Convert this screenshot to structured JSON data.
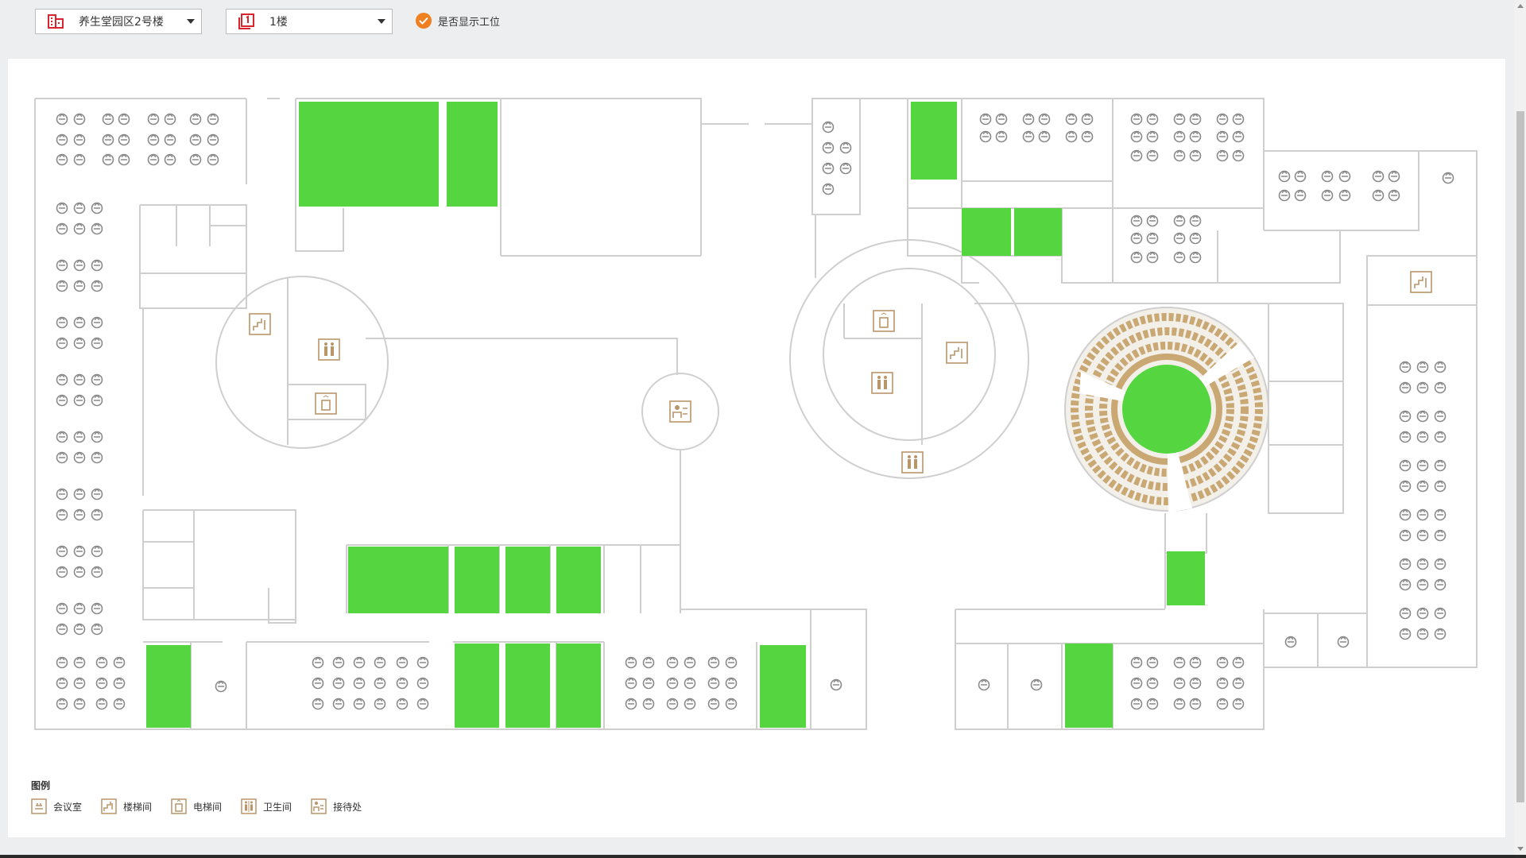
{
  "toolbar": {
    "building_select": {
      "value": "养生堂园区2号楼",
      "icon": "building-icon"
    },
    "floor_select": {
      "value": "1楼",
      "icon": "floor-icon"
    },
    "show_workstations": {
      "label": "是否显示工位",
      "checked": true
    }
  },
  "legend": {
    "title": "图例",
    "items": [
      {
        "icon": "meeting-room-icon",
        "label": "会议室"
      },
      {
        "icon": "stairs-icon",
        "label": "楼梯间"
      },
      {
        "icon": "elevator-icon",
        "label": "电梯间"
      },
      {
        "icon": "restroom-icon",
        "label": "卫生间"
      },
      {
        "icon": "reception-icon",
        "label": "接待处"
      }
    ]
  },
  "colors": {
    "room_available": "#55d641",
    "wall": "#cfcfcf",
    "seat": "#8a8a8a",
    "facility_icon": "#b9956a",
    "accent": "#f07f1f",
    "building_icon": "#d9232d"
  }
}
